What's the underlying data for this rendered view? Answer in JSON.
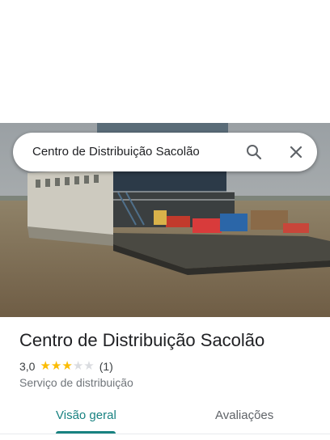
{
  "search": {
    "query": "Centro de Distribuição Sacolão"
  },
  "place": {
    "name": "Centro de Distribuição Sacolão",
    "rating_text": "3,0",
    "rating_value": 3.0,
    "rating_max": 5,
    "review_count": "(1)",
    "category": "Serviço de distribuição"
  },
  "tabs": [
    {
      "label": "Visão geral",
      "selected": true
    },
    {
      "label": "Avaliações",
      "selected": false
    }
  ],
  "colors": {
    "accent": "#188281",
    "star": "#fbbc04",
    "star_empty": "#dadce0"
  },
  "icons": {
    "search": "search-icon",
    "close": "close-icon"
  }
}
